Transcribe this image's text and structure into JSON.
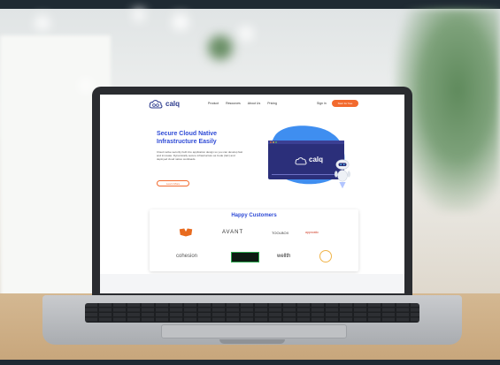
{
  "website": {
    "logo_text": "calq",
    "nav": {
      "items": [
        "Product",
        "Resources",
        "About Us",
        "Pricing"
      ],
      "sign_in": "Sign in",
      "cta": "Start for free"
    },
    "hero": {
      "title": "Secure Cloud Native Infrastructure Easily",
      "description": "Cloud native security built into application design so you can develop fast and innovate. Dynamically secure infrastructure as Code (IaC) and deployed cloud native workloads.",
      "button": "Learn More",
      "window_logo": "calq"
    },
    "customers": {
      "title": "Happy Customers",
      "logos": [
        "AVANT",
        "TOOLBOX",
        "appnostic",
        "cohesion",
        "wellth"
      ]
    }
  },
  "colors": {
    "brand_blue": "#2f4bd6",
    "accent_orange": "#f26a2e",
    "screen_navy": "#2b2f7a"
  }
}
